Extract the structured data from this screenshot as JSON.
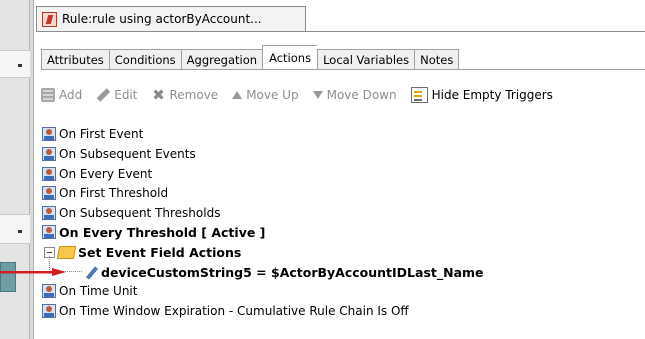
{
  "editor_tab": {
    "title": "Rule:rule using actorByAccount..."
  },
  "subtabs": [
    {
      "label": "Attributes",
      "active": false
    },
    {
      "label": "Conditions",
      "active": false
    },
    {
      "label": "Aggregation",
      "active": false
    },
    {
      "label": "Actions",
      "active": true
    },
    {
      "label": "Local Variables",
      "active": false
    },
    {
      "label": "Notes",
      "active": false
    }
  ],
  "toolbar": {
    "add": "Add",
    "edit": "Edit",
    "remove": "Remove",
    "move_up": "Move Up",
    "move_down": "Move Down",
    "hide_empty": "Hide Empty Triggers"
  },
  "tree": {
    "on_first_event": "On First Event",
    "on_subsequent_events": "On Subsequent Events",
    "on_every_event": "On Every Event",
    "on_first_threshold": "On First Threshold",
    "on_subsequent_thresholds": "On Subsequent Thresholds",
    "on_every_threshold": "On Every Threshold [ Active ]",
    "set_event_field_actions": "Set Event Field Actions",
    "field_action": "deviceCustomString5 = $ActorByAccountIDLast_Name",
    "on_time_unit": "On Time Unit",
    "on_time_window_expiration": "On Time Window Expiration - Cumulative Rule Chain Is Off"
  },
  "colors": {
    "arrow": "#d01f1f",
    "disabled_text": "#8e8e8e"
  }
}
